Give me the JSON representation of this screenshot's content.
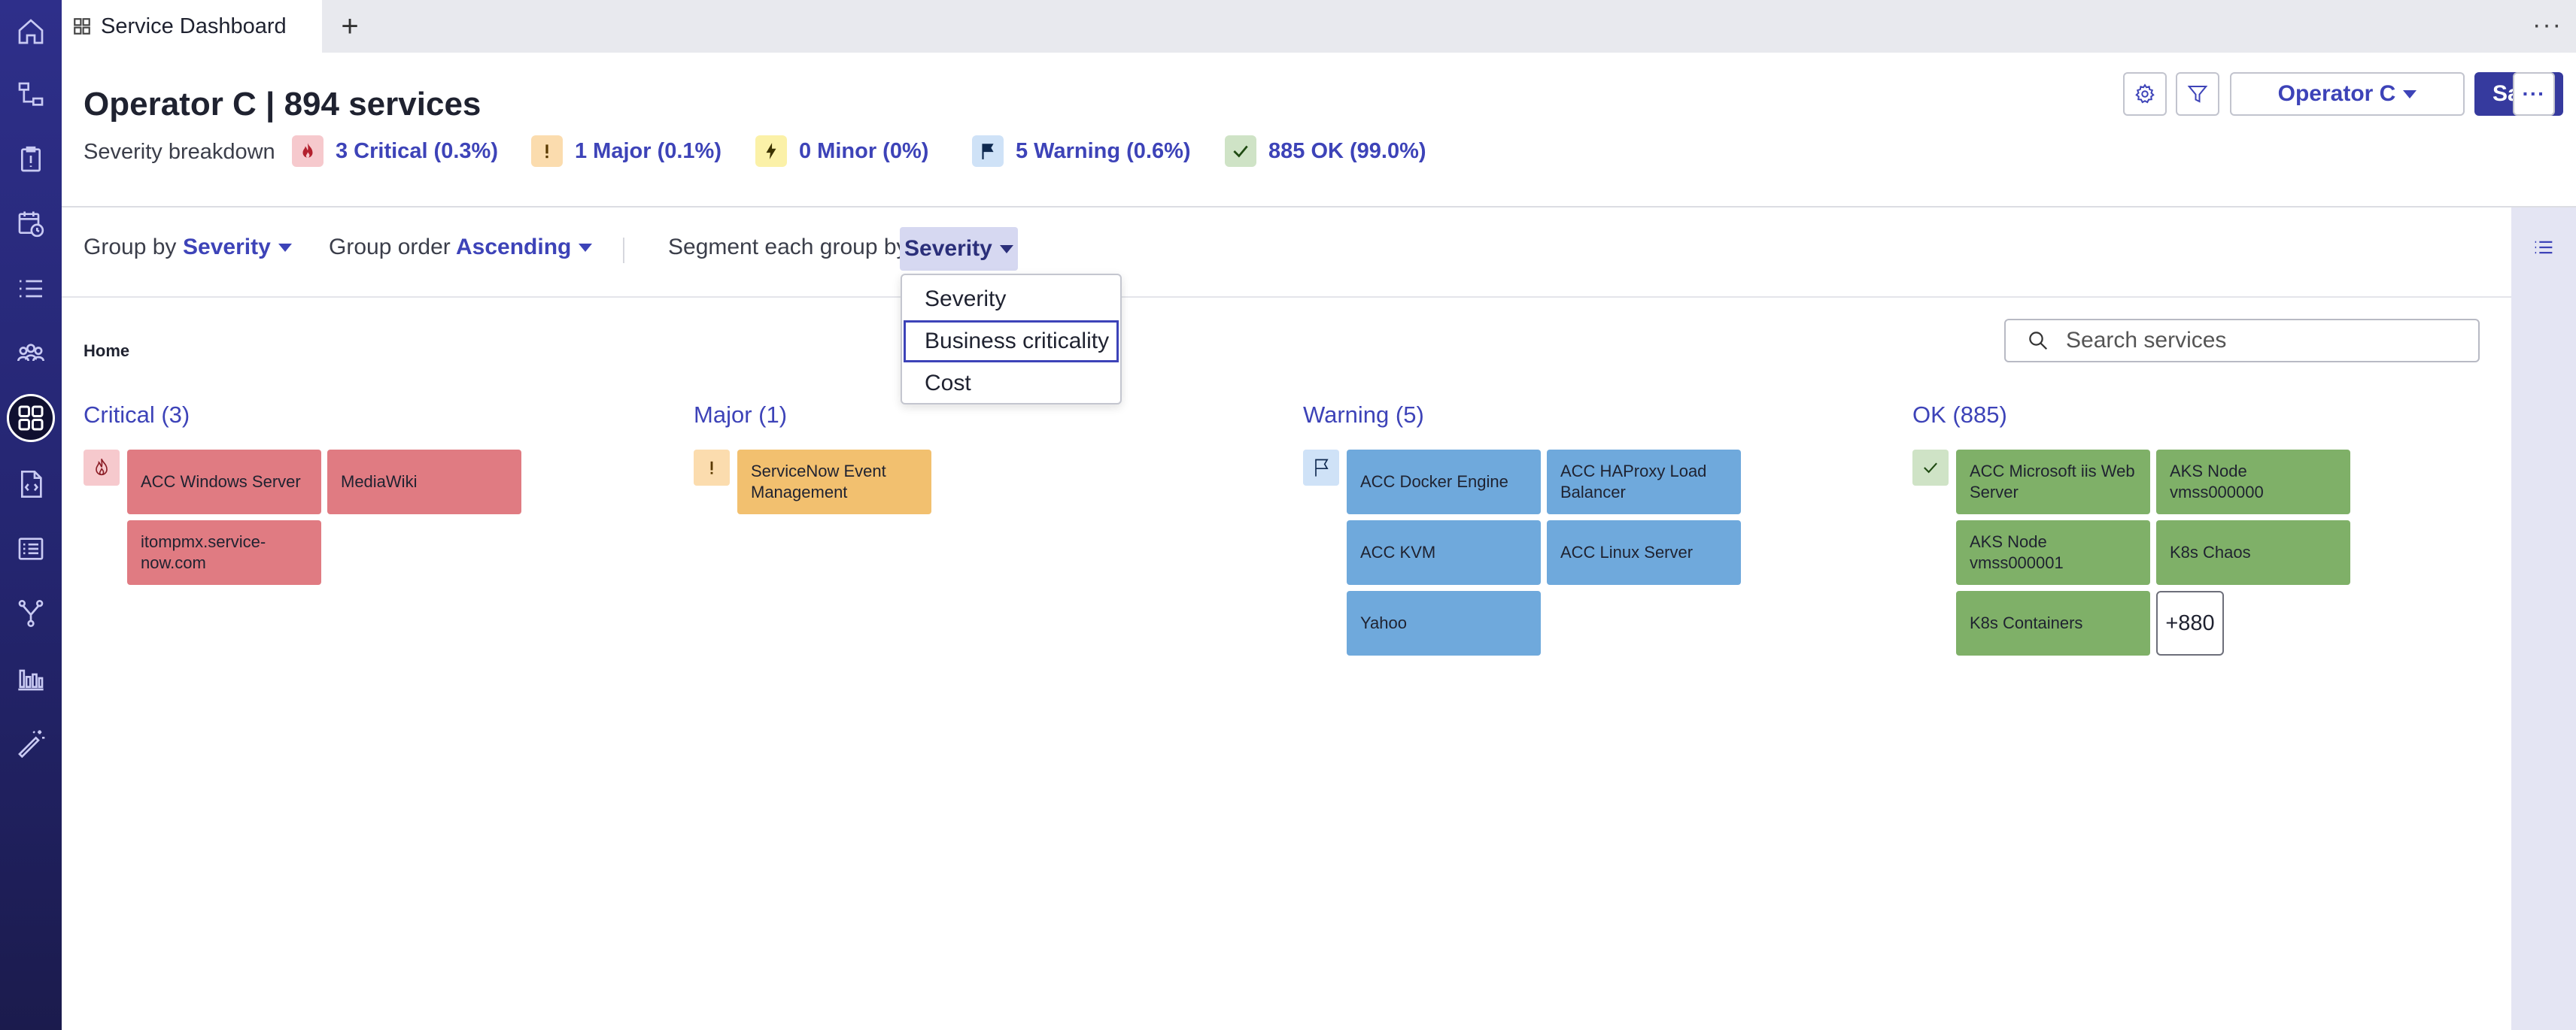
{
  "tab": {
    "title": "Service Dashboard",
    "add_label": "+",
    "more_label": "···"
  },
  "sidebar": {
    "items": [
      {
        "icon": "home-icon"
      },
      {
        "icon": "hierarchy-icon"
      },
      {
        "icon": "clipboard-icon"
      },
      {
        "icon": "calendar-clock-icon"
      },
      {
        "icon": "list-icon"
      },
      {
        "icon": "group-icon"
      },
      {
        "icon": "dashboard-grid-icon",
        "active": true
      },
      {
        "icon": "code-file-icon"
      },
      {
        "icon": "table-list-icon"
      },
      {
        "icon": "branch-icon"
      },
      {
        "icon": "bar-chart-icon"
      },
      {
        "icon": "magic-wand-icon"
      }
    ]
  },
  "header": {
    "title": "Operator C | 894 services",
    "severity_label": "Severity breakdown",
    "severities": [
      {
        "label": "3 Critical (0.3%)",
        "icon": "flame-icon",
        "color": "#f6c9cd"
      },
      {
        "label": "1 Major (0.1%)",
        "icon": "exclamation-icon",
        "color": "#fbdcae"
      },
      {
        "label": "0 Minor (0%)",
        "icon": "lightning-icon",
        "color": "#fbf1a8"
      },
      {
        "label": "5 Warning (0.6%)",
        "icon": "flag-icon",
        "color": "#cfe2f7"
      },
      {
        "label": "885 OK (99.0%)",
        "icon": "check-icon",
        "color": "#cfe3c6"
      }
    ],
    "operator_button": "Operator C",
    "save_button": "Save",
    "more_button": "···"
  },
  "toolbar": {
    "group_by_label": "Group by",
    "group_by_value": "Severity",
    "group_order_label": "Group order",
    "group_order_value": "Ascending",
    "segment_label": "Segment each group by",
    "segment_value": "Severity"
  },
  "dropdown": {
    "options": [
      "Severity",
      "Business criticality",
      "Cost"
    ],
    "focused_index": 1
  },
  "breadcrumb": "Home",
  "search": {
    "placeholder": "Search services"
  },
  "groups": [
    {
      "title": "Critical (3)",
      "icon": "flame-icon",
      "chip_color": "#f6c9cd",
      "services": [
        "ACC Windows Server",
        "MediaWiki",
        "itompmx.service-now.com"
      ]
    },
    {
      "title": "Major (1)",
      "icon": "exclamation-icon",
      "chip_color": "#fbdcae",
      "services": [
        "ServiceNow Event Management"
      ]
    },
    {
      "title": "Warning (5)",
      "icon": "flag-icon",
      "chip_color": "#cfe2f7",
      "services": [
        "ACC Docker Engine",
        "ACC HAProxy Load Balancer",
        "ACC KVM",
        "ACC Linux Server",
        "Yahoo"
      ]
    },
    {
      "title": "OK (885)",
      "icon": "check-icon",
      "chip_color": "#cfe3c6",
      "services": [
        "ACC Microsoft iis Web Server",
        "AKS Node vmss000000",
        "AKS Node vmss000001",
        "K8s Chaos",
        "K8s Containers"
      ],
      "more_label": "+880"
    }
  ],
  "colors": {
    "accent": "#3d43b8",
    "critical": "#e07b82",
    "major": "#f2c06f",
    "warning": "#6fa9dc",
    "ok": "#7fb068"
  }
}
